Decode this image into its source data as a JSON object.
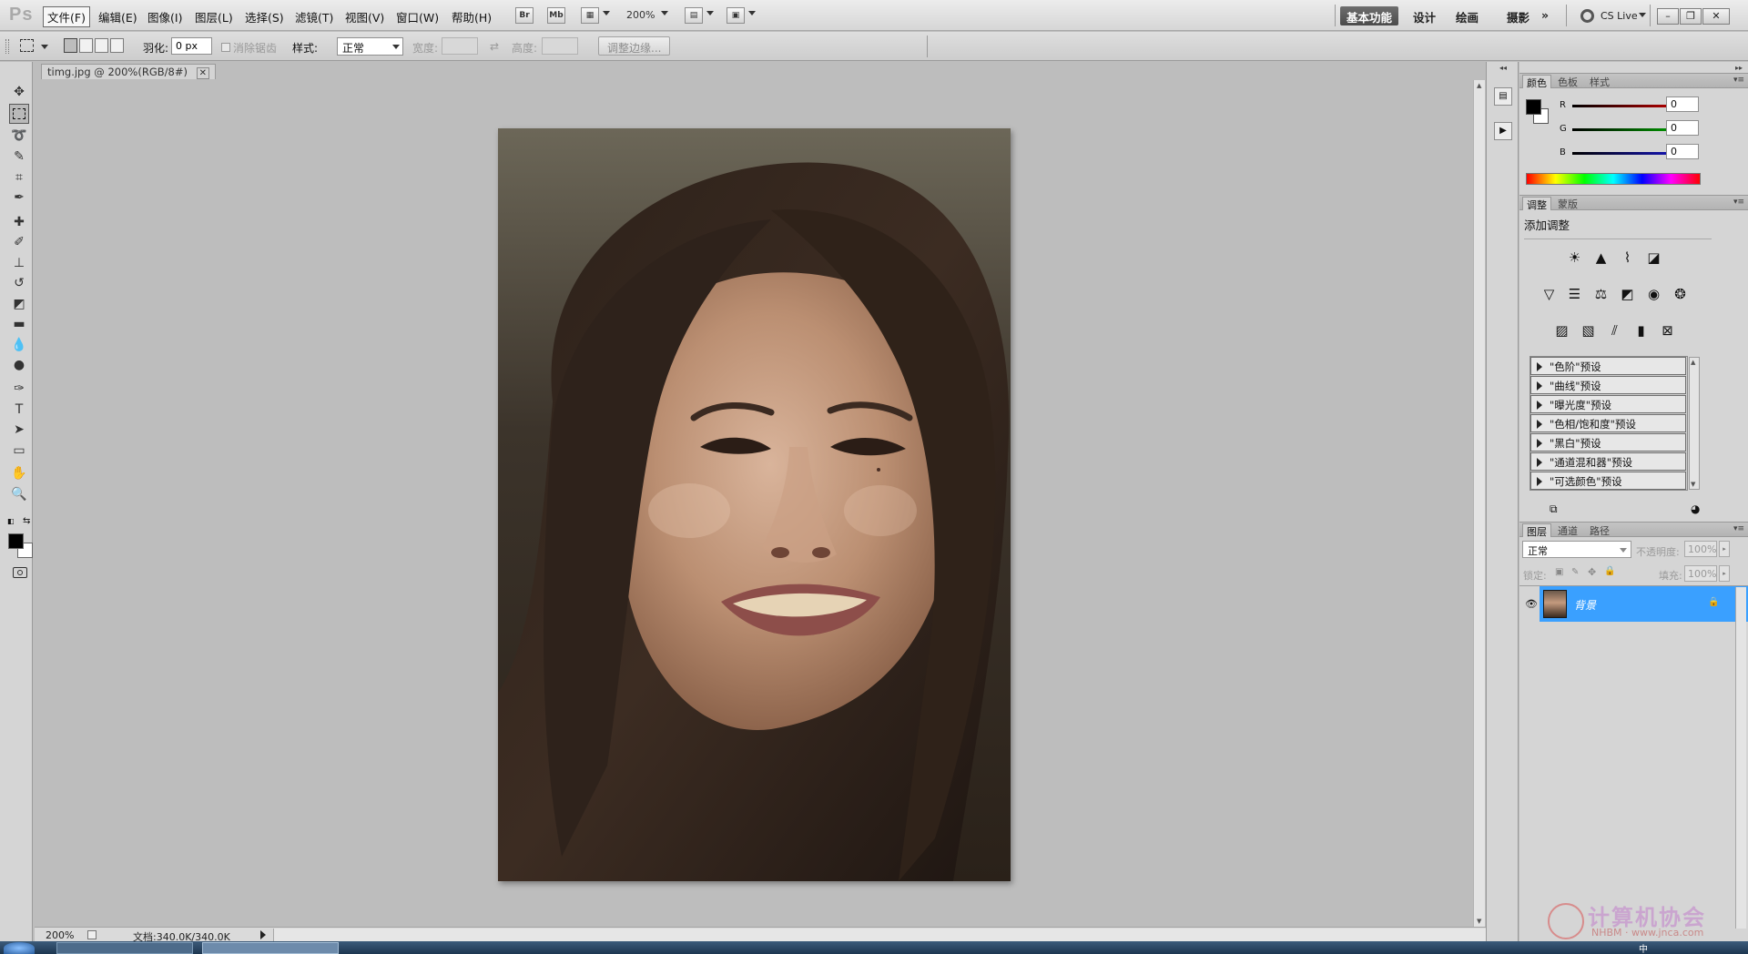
{
  "app": {
    "logo": "Ps"
  },
  "menu": [
    {
      "label": "文件(F)",
      "active": true
    },
    {
      "label": "编辑(E)"
    },
    {
      "label": "图像(I)"
    },
    {
      "label": "图层(L)"
    },
    {
      "label": "选择(S)"
    },
    {
      "label": "滤镜(T)"
    },
    {
      "label": "视图(V)"
    },
    {
      "label": "窗口(W)"
    },
    {
      "label": "帮助(H)"
    }
  ],
  "appbar": {
    "br": "Br",
    "mb": "Mb",
    "zoom": "200%"
  },
  "workspaces": [
    "基本功能",
    "设计",
    "绘画",
    "摄影"
  ],
  "workspace_more": "»",
  "cs_live": "CS Live",
  "window_controls": {
    "minimize": "–",
    "restore": "❐",
    "close": "✕"
  },
  "options": {
    "feather_label": "羽化:",
    "feather_value": "0 px",
    "antialias_label": "消除锯齿",
    "style_label": "样式:",
    "style_value": "正常",
    "width_label": "宽度:",
    "swap_icon": "⇄",
    "height_label": "高度:",
    "refine_edge": "调整边缘..."
  },
  "document": {
    "tab_title": "timg.jpg @ 200%(RGB/8#)",
    "close": "✕"
  },
  "status": {
    "zoom": "200%",
    "doc_info": "文档:340.0K/340.0K"
  },
  "color_panel": {
    "tabs": [
      "颜色",
      "色板",
      "样式"
    ],
    "channels": [
      {
        "label": "R",
        "value": "0",
        "color": "#d40000"
      },
      {
        "label": "G",
        "value": "0",
        "color": "#00b000"
      },
      {
        "label": "B",
        "value": "0",
        "color": "#1a1ad4"
      }
    ]
  },
  "adjust_panel": {
    "tabs": [
      "调整",
      "蒙版"
    ],
    "heading": "添加调整",
    "presets": [
      "\"色阶\"预设",
      "\"曲线\"预设",
      "\"曝光度\"预设",
      "\"色相/饱和度\"预设",
      "\"黑白\"预设",
      "\"通道混和器\"预设",
      "\"可选颜色\"预设"
    ]
  },
  "layers_panel": {
    "tabs": [
      "图层",
      "通道",
      "路径"
    ],
    "blend_mode": "正常",
    "opacity_label": "不透明度:",
    "opacity_value": "100%",
    "lock_label": "锁定:",
    "fill_label": "填充:",
    "fill_value": "100%",
    "layer_name": "背景"
  },
  "watermark": {
    "text": "计算机协会",
    "sub": "NHBM · www.jnca.com"
  },
  "taskbar": {
    "ime": "中"
  },
  "colors": {
    "accent": "#3aa0ff",
    "ws_active": "#555555",
    "foreground": "#000000",
    "background": "#ffffff"
  }
}
